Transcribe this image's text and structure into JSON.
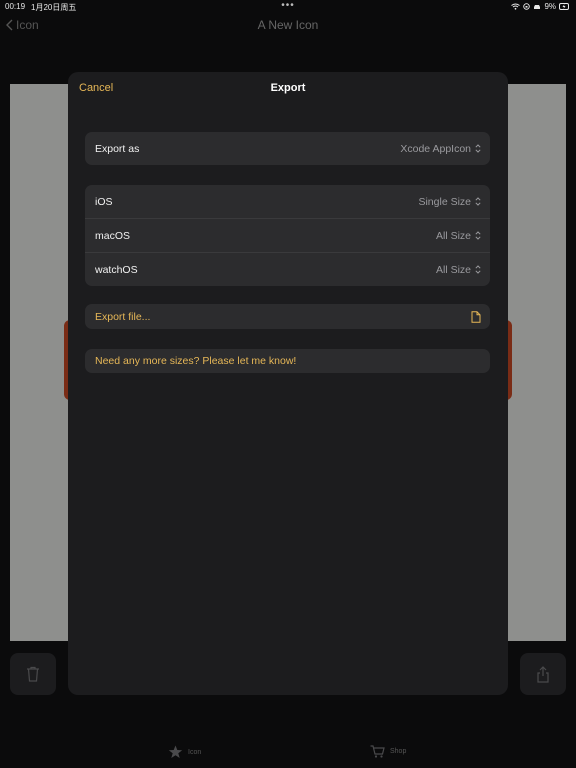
{
  "status_bar": {
    "time": "00:19",
    "date": "1月20日周五",
    "multitask_dots": "•••",
    "battery": "9%"
  },
  "background": {
    "back_label": "Icon",
    "title": "A New Icon",
    "tabs": [
      {
        "label": "Icon",
        "icon": "star-icon"
      },
      {
        "label": "Shop",
        "icon": "cart-icon"
      }
    ]
  },
  "export_sheet": {
    "cancel_label": "Cancel",
    "title": "Export",
    "export_as": {
      "label": "Export as",
      "value": "Xcode AppIcon"
    },
    "platforms": [
      {
        "label": "iOS",
        "value": "Single Size"
      },
      {
        "label": "macOS",
        "value": "All Size"
      },
      {
        "label": "watchOS",
        "value": "All Size"
      }
    ],
    "export_file_label": "Export file...",
    "more_sizes_label": "Need any more sizes? Please let me know!"
  },
  "colors": {
    "accent": "#e6b757",
    "sheet_background": "#1c1c1e",
    "row_background": "#2c2c2e"
  }
}
